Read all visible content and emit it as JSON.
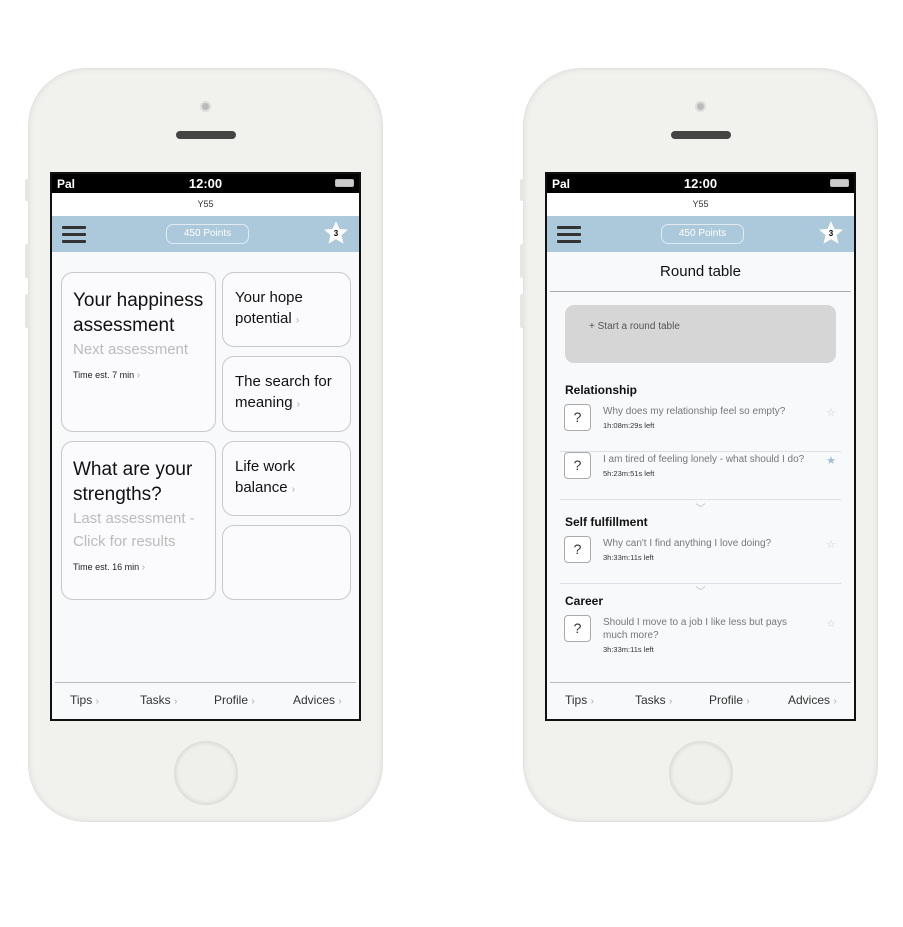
{
  "status": {
    "carrier": "Pal",
    "time": "12:00"
  },
  "app_name": "Y55",
  "header": {
    "points": "450 Points",
    "star_count": "3"
  },
  "footer": [
    "Tips",
    "Tasks",
    "Profile",
    "Advices"
  ],
  "chevron": "›",
  "home": {
    "tiles": [
      {
        "title": "Your happiness assessment",
        "sub": "Next assessment",
        "est": "Time est. 7 min"
      },
      {
        "title": "Your hope potential"
      },
      {
        "title": "The search for meaning"
      },
      {
        "title": "What are your strengths?",
        "sub": "Last assessment - Click for results",
        "est": "Time est. 16 min"
      },
      {
        "title": "Life work balance"
      },
      {
        "title": ""
      }
    ]
  },
  "round_table": {
    "title": "Round table",
    "start": "+ Start a round table",
    "sections": [
      {
        "name": "Relationship",
        "items": [
          {
            "q": "Why does my relationship feel so empty?",
            "time": "1h:08m:29s left",
            "starred": false
          },
          {
            "q": "I am tired of feeling lonely - what should I do?",
            "time": "5h:23m:51s left",
            "starred": true
          }
        ]
      },
      {
        "name": "Self fulfillment",
        "items": [
          {
            "q": "Why can't I find anything I love doing?",
            "time": "3h:33m:11s left",
            "starred": false
          }
        ]
      },
      {
        "name": "Career",
        "items": [
          {
            "q": "Should I move to a job I like less but pays much more?",
            "time": "3h:33m:11s left",
            "starred": false
          }
        ]
      }
    ]
  },
  "colors": {
    "header": "#abc9da",
    "star_active": "#9ec0d4"
  }
}
